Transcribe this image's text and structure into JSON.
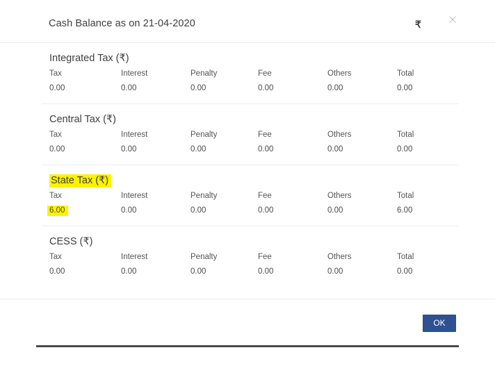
{
  "dialog": {
    "title": "Cash Balance as on 21-04-2020",
    "currency_icon": "₹",
    "currency_icon_name": "rupee-icon",
    "close_icon": "×",
    "ok_label": "OK",
    "accent_color": "#2c5291",
    "highlight_color": "#fff200"
  },
  "columns": [
    "Tax",
    "Interest",
    "Penalty",
    "Fee",
    "Others",
    "Total"
  ],
  "sections": [
    {
      "title": "Integrated Tax (₹)",
      "highlighted": false,
      "values": [
        "0.00",
        "0.00",
        "0.00",
        "0.00",
        "0.00",
        "0.00"
      ],
      "highlighted_cells": []
    },
    {
      "title": "Central Tax (₹)",
      "highlighted": false,
      "values": [
        "0.00",
        "0.00",
        "0.00",
        "0.00",
        "0.00",
        "0.00"
      ],
      "highlighted_cells": []
    },
    {
      "title": "State Tax (₹)",
      "highlighted": true,
      "values": [
        "6.00",
        "0.00",
        "0.00",
        "0.00",
        "0.00",
        "6.00"
      ],
      "highlighted_cells": [
        0
      ]
    },
    {
      "title": "CESS (₹)",
      "highlighted": false,
      "values": [
        "0.00",
        "0.00",
        "0.00",
        "0.00",
        "0.00",
        "0.00"
      ],
      "highlighted_cells": []
    }
  ]
}
